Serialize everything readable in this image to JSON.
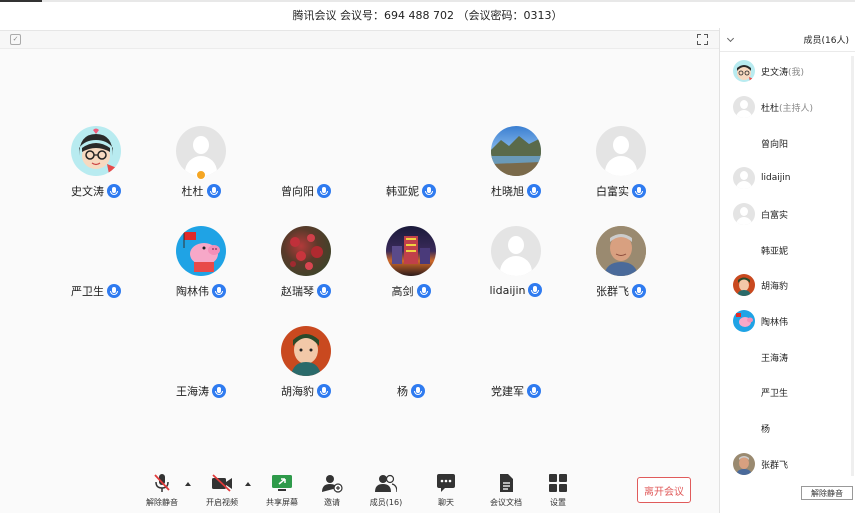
{
  "window": {
    "title": "腾讯会议 会议号：694 488 702 （会议密码：0313）"
  },
  "tiles": [
    {
      "name": "史文涛",
      "avatar": "cartoon-boy"
    },
    {
      "name": "杜杜",
      "avatar": "default",
      "host": true
    },
    {
      "name": "曾向阳",
      "avatar": "none"
    },
    {
      "name": "韩亚妮",
      "avatar": "none"
    },
    {
      "name": "杜晓旭",
      "avatar": "landscape-photo"
    },
    {
      "name": "白富实",
      "avatar": "default"
    },
    {
      "name": "严卫生",
      "avatar": "none"
    },
    {
      "name": "陶林伟",
      "avatar": "peppa-pig"
    },
    {
      "name": "赵瑞琴",
      "avatar": "flowers-photo"
    },
    {
      "name": "高剑",
      "avatar": "night-building-photo"
    },
    {
      "name": "lidaijin",
      "avatar": "default"
    },
    {
      "name": "张群飞",
      "avatar": "portrait-photo"
    },
    {
      "name": "王海涛",
      "avatar": "none"
    },
    {
      "name": "胡海豹",
      "avatar": "painted-portrait"
    },
    {
      "name": "杨",
      "avatar": "none"
    },
    {
      "name": "党建军",
      "avatar": "none"
    }
  ],
  "toolbar": {
    "unmute": "解除静音",
    "video": "开启视频",
    "share": "共享屏幕",
    "invite": "邀请",
    "members": "成员(16)",
    "chat": "聊天",
    "docs": "会议文档",
    "settings": "设置",
    "leave": "离开会议"
  },
  "sidebar": {
    "title": "成员(16人)",
    "members": [
      {
        "name": "史文涛",
        "role": "(我)",
        "avatar": "cartoon-boy"
      },
      {
        "name": "杜杜",
        "role": "(主持人)",
        "avatar": "default"
      },
      {
        "name": "曾向阳",
        "role": "",
        "avatar": "none"
      },
      {
        "name": "lidaijin",
        "role": "",
        "avatar": "default"
      },
      {
        "name": "白富实",
        "role": "",
        "avatar": "default"
      },
      {
        "name": "韩亚妮",
        "role": "",
        "avatar": "none"
      },
      {
        "name": "胡海豹",
        "role": "",
        "avatar": "painted-portrait"
      },
      {
        "name": "陶林伟",
        "role": "",
        "avatar": "peppa-pig"
      },
      {
        "name": "王海涛",
        "role": "",
        "avatar": "none"
      },
      {
        "name": "严卫生",
        "role": "",
        "avatar": "none"
      },
      {
        "name": "杨",
        "role": "",
        "avatar": "none"
      },
      {
        "name": "张群飞",
        "role": "",
        "avatar": "portrait-photo"
      }
    ],
    "unmute_all": "解除静音"
  },
  "colors": {
    "accent": "#2f7bf0",
    "leave": "#e05b5b",
    "host_badge": "#f5a623"
  }
}
